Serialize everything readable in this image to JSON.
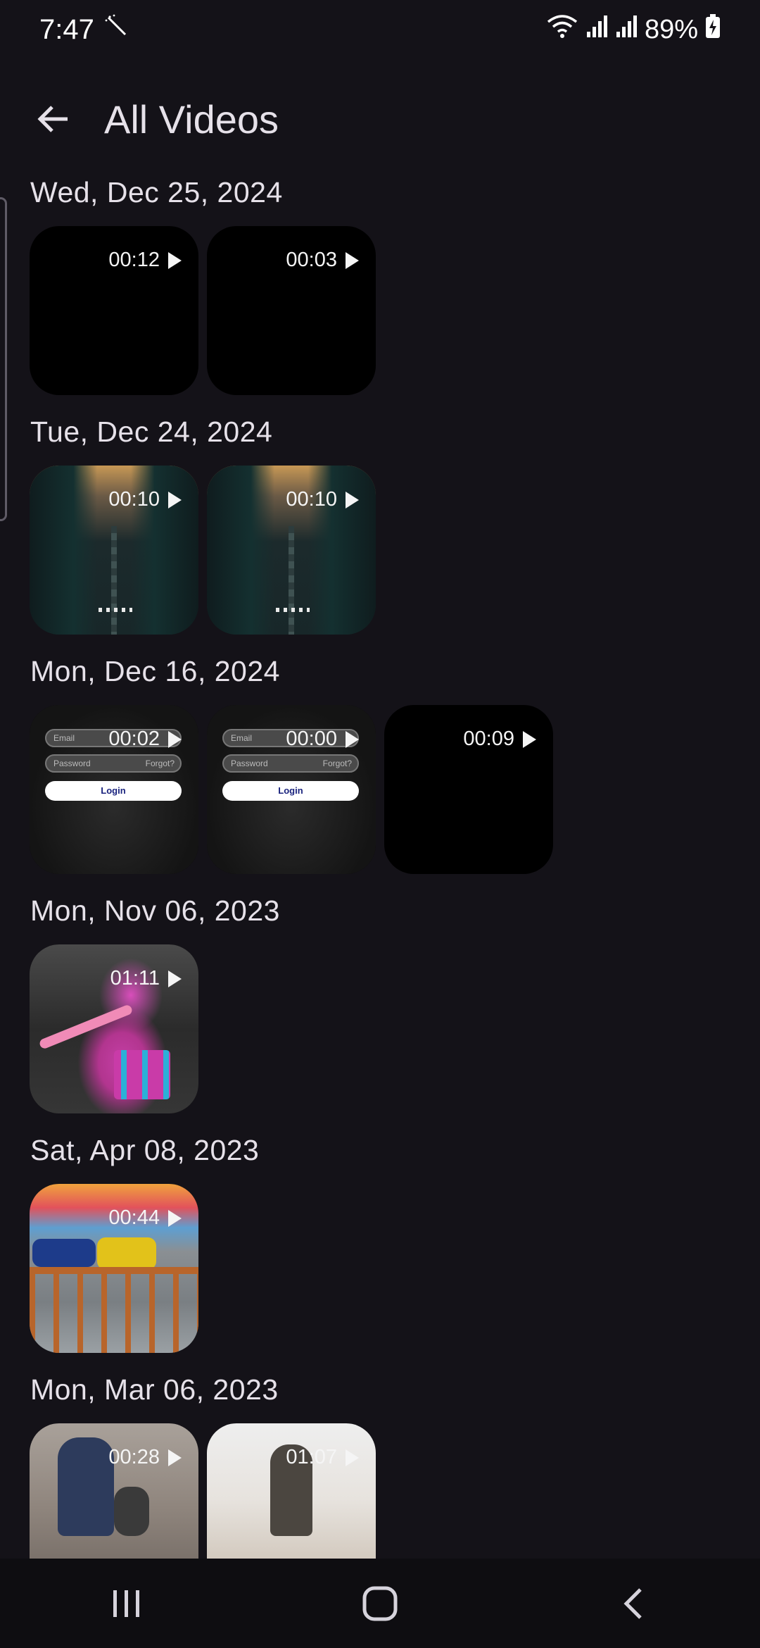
{
  "status_bar": {
    "time": "7:47",
    "battery_percent": "89%"
  },
  "header": {
    "title": "All Videos"
  },
  "groups": [
    {
      "date": "Wed, Dec 25, 2024",
      "videos": [
        {
          "duration": "00:12"
        },
        {
          "duration": "00:03"
        }
      ]
    },
    {
      "date": "Tue, Dec 24, 2024",
      "videos": [
        {
          "duration": "00:10"
        },
        {
          "duration": "00:10"
        }
      ]
    },
    {
      "date": "Mon, Dec 16, 2024",
      "videos": [
        {
          "duration": "00:02",
          "thumb_text": {
            "email": "Email",
            "password": "Password",
            "forgot": "Forgot?",
            "login": "Login"
          }
        },
        {
          "duration": "00:00",
          "thumb_text": {
            "email": "Email",
            "password": "Password",
            "forgot": "Forgot?",
            "login": "Login"
          }
        },
        {
          "duration": "00:09"
        }
      ]
    },
    {
      "date": "Mon, Nov 06, 2023",
      "videos": [
        {
          "duration": "01:11"
        }
      ]
    },
    {
      "date": "Sat, Apr 08, 2023",
      "videos": [
        {
          "duration": "00:44"
        }
      ]
    },
    {
      "date": "Mon, Mar 06, 2023",
      "videos": [
        {
          "duration": "00:28"
        },
        {
          "duration": "01:07"
        }
      ]
    }
  ]
}
